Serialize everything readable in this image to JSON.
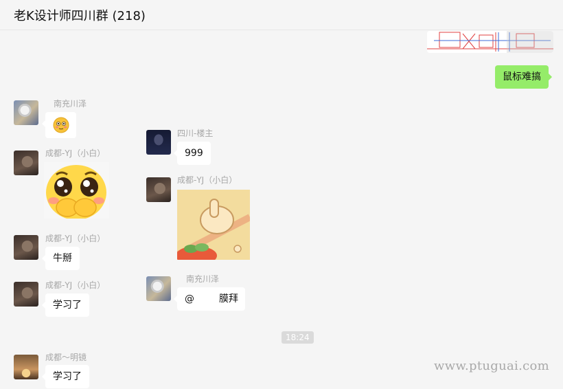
{
  "window": {
    "title": "老K设计师四川群 (218)"
  },
  "messages": {
    "m_self": {
      "text": "鼠标难搞"
    },
    "m1": {
      "sender": "南充川泽"
    },
    "m2": {
      "sender": "四川-楼主",
      "text": "999"
    },
    "m3": {
      "sender": "成都-YJ（小白）"
    },
    "m4": {
      "sender": "成都-YJ（小白）"
    },
    "m5": {
      "sender": "成都-YJ（小白）",
      "text": "牛掰"
    },
    "m6": {
      "sender": "南充川泽",
      "at": "@",
      "text": "膜拜"
    },
    "m7": {
      "sender": "成都-YJ（小白）",
      "text": "学习了"
    },
    "time": "18:24",
    "m8": {
      "sender": "成都～明镜",
      "text": "学习了"
    }
  },
  "watermark": "www.ptuguai.com",
  "colors": {
    "background": "#f5f5f5",
    "self_bubble": "#95ec69",
    "other_bubble": "#ffffff",
    "name_text": "#a7a7a7"
  }
}
